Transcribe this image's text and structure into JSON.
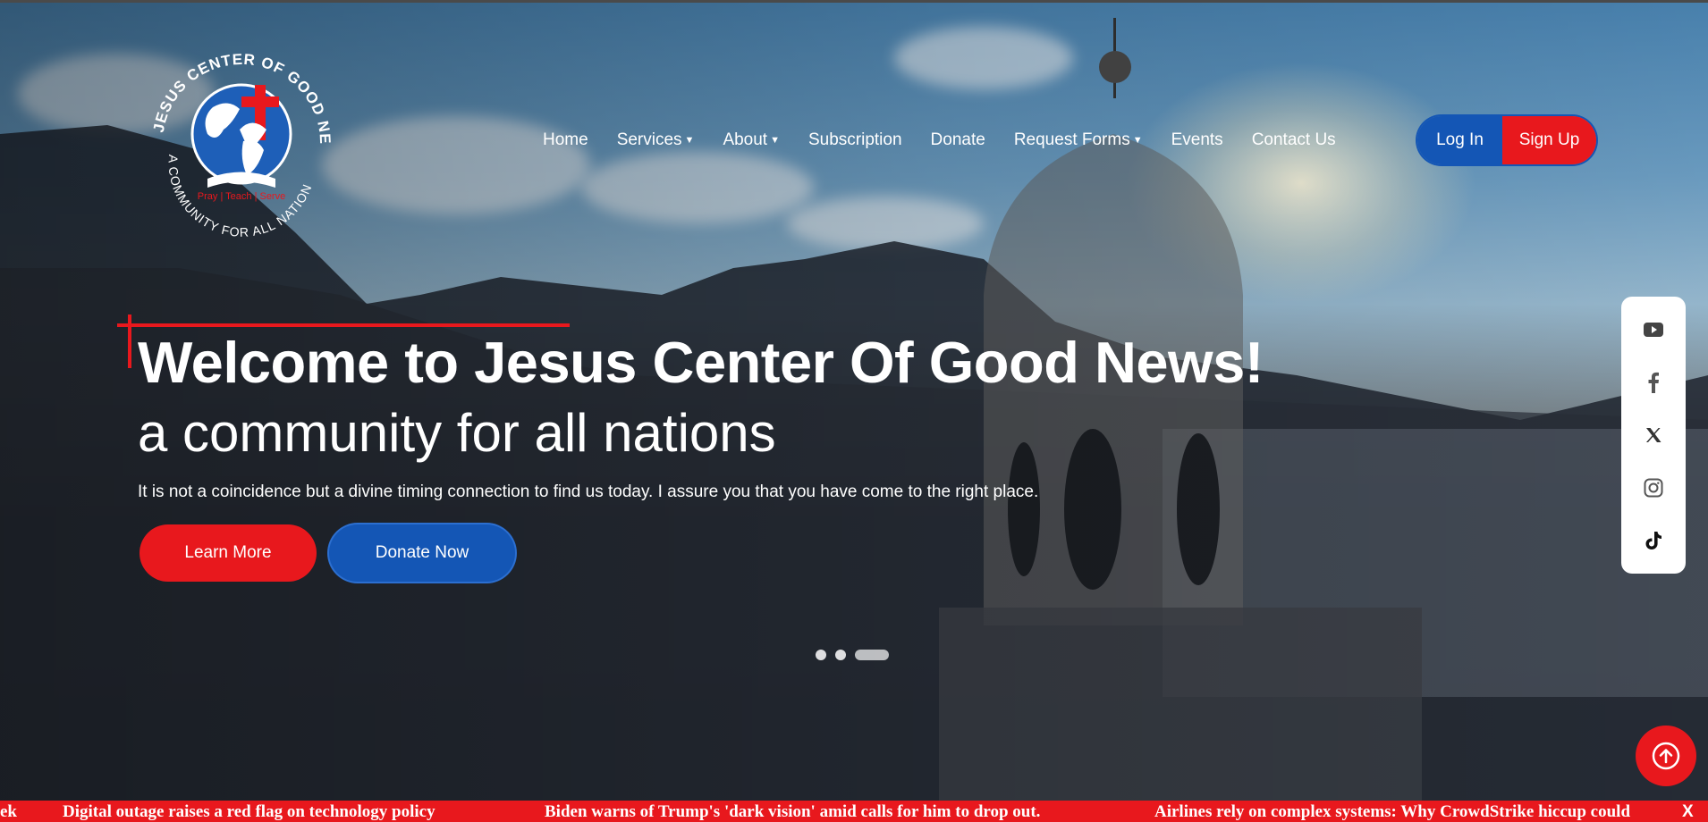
{
  "logo": {
    "arc_text_top": "JESUS CENTER OF GOOD NEWS",
    "arc_text_bottom": "A COMMUNITY FOR ALL NATIONS",
    "motto": "Pray | Teach | Serve"
  },
  "nav": {
    "items": [
      {
        "label": "Home",
        "dropdown": false
      },
      {
        "label": "Services",
        "dropdown": true
      },
      {
        "label": "About",
        "dropdown": true
      },
      {
        "label": "Subscription",
        "dropdown": false
      },
      {
        "label": "Donate",
        "dropdown": false
      },
      {
        "label": "Request Forms",
        "dropdown": true
      },
      {
        "label": "Events",
        "dropdown": false
      },
      {
        "label": "Contact Us",
        "dropdown": false
      }
    ],
    "login_label": "Log In",
    "signup_label": "Sign Up"
  },
  "hero": {
    "headline": "Welcome to Jesus Center Of Good News!",
    "subheadline": "a community for all nations",
    "tagline": "It is not a coincidence but a divine timing connection to find us today. I assure you that you have come to the right place.",
    "learn_more_label": "Learn More",
    "donate_now_label": "Donate Now",
    "slides_total": 3,
    "slide_active": 3
  },
  "social": [
    "youtube-icon",
    "facebook-icon",
    "x-icon",
    "instagram-icon",
    "tiktok-icon"
  ],
  "ticker": {
    "start_fragment": "ek",
    "headlines": [
      "Digital outage raises a red flag on technology policy",
      "Biden warns of Trump's 'dark vision' amid calls for him to drop out.",
      "Airlines rely on complex systems: Why CrowdStrike hiccup could"
    ],
    "close_glyph": "X"
  },
  "colors": {
    "brand_red": "#e8181d",
    "brand_blue": "#1456b5"
  }
}
